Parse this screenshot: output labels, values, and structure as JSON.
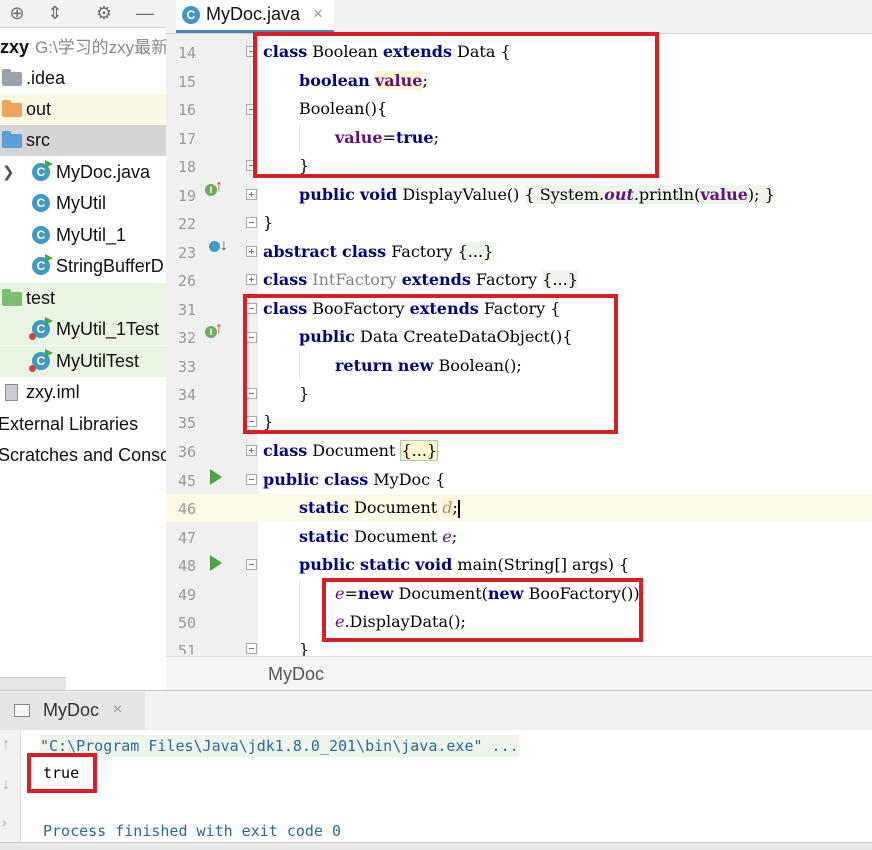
{
  "project": {
    "root_name": "zxy",
    "root_path": "G:\\学习的zxy最新",
    "items": [
      {
        "label": ".idea"
      },
      {
        "label": "out"
      },
      {
        "label": "src"
      },
      {
        "label": "MyDoc.java"
      },
      {
        "label": "MyUtil"
      },
      {
        "label": "MyUtil_1"
      },
      {
        "label": "StringBufferD"
      },
      {
        "label": "test"
      },
      {
        "label": "MyUtil_1Test"
      },
      {
        "label": "MyUtilTest"
      },
      {
        "label": "zxy.iml"
      },
      {
        "label": "External Libraries"
      },
      {
        "label": "Scratches and Conso"
      }
    ]
  },
  "editor": {
    "tab_label": "MyDoc.java",
    "tab_close": "×",
    "breadcrumb": "MyDoc",
    "line_numbers": [
      "14",
      "15",
      "16",
      "17",
      "18",
      "19",
      "22",
      "23",
      "26",
      "31",
      "32",
      "33",
      "34",
      "35",
      "36",
      "45",
      "46",
      "47",
      "48",
      "49",
      "50",
      "51"
    ],
    "code": {
      "l14": {
        "kw1": "class",
        "t1": " Boolean ",
        "kw2": "extends",
        "t2": " Data {"
      },
      "l15": {
        "kw1": "boolean",
        "t1": " ",
        "fld": "value",
        "t2": ";"
      },
      "l16": {
        "t1": "Boolean(){"
      },
      "l17": {
        "fld": "value",
        "t1": "=",
        "kw1": "true",
        "t2": ";"
      },
      "l18": {
        "t1": "}"
      },
      "l19": {
        "kw1": "public",
        "t0": " ",
        "kw2": "void",
        "t1": " DisplayValue() ",
        "fold": "{ System.",
        "itf": "out",
        "t2": ".println(",
        "fld": "value",
        "t3": "); }"
      },
      "l22": {
        "t1": "}"
      },
      "l23": {
        "kw1": "abstract",
        "t0": " ",
        "kw2": "class",
        "t1": " Factory ",
        "fold": "{...}"
      },
      "l26": {
        "kw1": "class",
        "t1": " ",
        "gray": "IntFactory",
        "t2": " ",
        "kw2": "extends",
        "t3": " Factory ",
        "fold": "{...}"
      },
      "l31": {
        "kw1": "class",
        "t1": " BooFactory ",
        "kw2": "extends",
        "t2": " Factory {"
      },
      "l32": {
        "kw1": "public",
        "t1": " Data CreateDataObject(){"
      },
      "l33": {
        "kw1": "return",
        "t0": " ",
        "kw2": "new",
        "t1": " Boolean();"
      },
      "l34": {
        "t1": "}"
      },
      "l35": {
        "t1": "}"
      },
      "l36": {
        "kw1": "class",
        "t1": " Document ",
        "fold": "{...}"
      },
      "l45": {
        "kw1": "public",
        "t0": " ",
        "kw2": "class",
        "t1": " MyDoc {"
      },
      "l46": {
        "kw1": "static",
        "t1": " Document ",
        "itf": "d",
        "t2": ";"
      },
      "l47": {
        "kw1": "static",
        "t1": " Document ",
        "itf": "e",
        "t2": ";"
      },
      "l48": {
        "kw1": "public",
        "t0": " ",
        "kw2": "static",
        "t00": " ",
        "kw3": "void",
        "t1": " main(String[] args) {"
      },
      "l49": {
        "itf": "e",
        "t1": "=",
        "kw1": "new",
        "t2": " Document(",
        "kw2": "new",
        "t3": " BooFactory());"
      },
      "l50": {
        "itf": "e",
        "t1": ".DisplayData();"
      },
      "l51": {
        "t1": "}"
      }
    }
  },
  "run": {
    "tab_label": "MyDoc",
    "tab_close": "×",
    "command": "\"C:\\Program Files\\Java\\jdk1.8.0_201\\bin\\java.exe\" ...",
    "output": "true",
    "exit_message": "Process finished with exit code 0"
  },
  "colors": {
    "keyword": "#000080",
    "field": "#660e7a",
    "highlight_box": "#d71f25",
    "tab_underline": "#4083c9"
  }
}
